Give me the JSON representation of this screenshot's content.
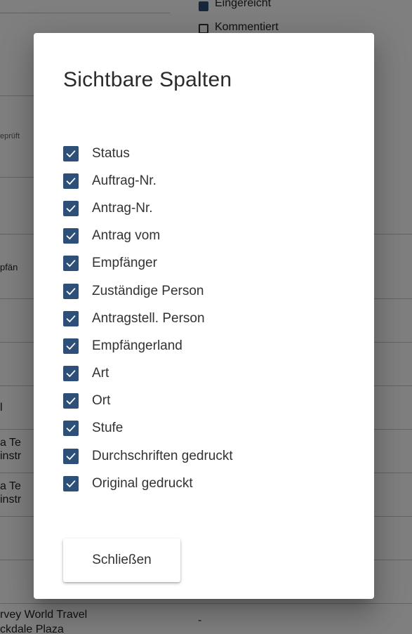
{
  "background": {
    "checkbox_submitted": "Eingereicht",
    "checkbox_commented": "Kommentiert",
    "fragment_checked": "eprüft",
    "fragment_recipient": "pfän",
    "fragment_l": "l",
    "fragment_a_te_1": "a Te",
    "fragment_instr_1": "instr",
    "fragment_a_te_2": "a Te",
    "fragment_instr_2": "instr",
    "fragment_travel": "rvey World Travel",
    "fragment_plaza": "ckdale Plaza",
    "fragment_dash": "-"
  },
  "dialog": {
    "title": "Sichtbare Spalten",
    "columns": [
      {
        "label": "Status",
        "checked": true
      },
      {
        "label": "Auftrag-Nr.",
        "checked": true
      },
      {
        "label": "Antrag-Nr.",
        "checked": true
      },
      {
        "label": "Antrag vom",
        "checked": true
      },
      {
        "label": "Empfänger",
        "checked": true
      },
      {
        "label": "Zuständige Person",
        "checked": true
      },
      {
        "label": "Antragstell. Person",
        "checked": true
      },
      {
        "label": "Empfängerland",
        "checked": true
      },
      {
        "label": "Art",
        "checked": true
      },
      {
        "label": "Ort",
        "checked": true
      },
      {
        "label": "Stufe",
        "checked": true
      },
      {
        "label": "Durchschriften gedruckt",
        "checked": true
      },
      {
        "label": "Original gedruckt",
        "checked": true
      }
    ],
    "close_label": "Schließen"
  },
  "colors": {
    "checkbox_fill": "#2e4f78",
    "overlay": "rgba(0,0,0,0.5)"
  }
}
